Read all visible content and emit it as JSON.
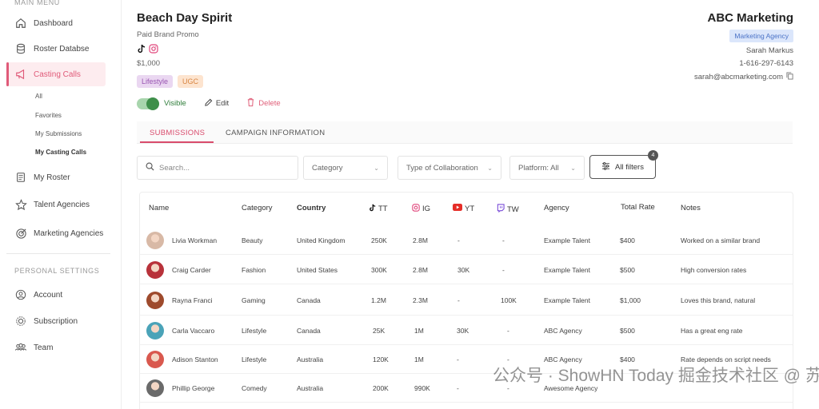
{
  "sidebar": {
    "main_menu_label": "MAIN MENU",
    "items": [
      {
        "label": "Dashboard"
      },
      {
        "label": "Roster Databse"
      },
      {
        "label": "Casting Calls"
      },
      {
        "label": "My Roster"
      },
      {
        "label": "Talent Agencies"
      },
      {
        "label": "Marketing Agencies"
      }
    ],
    "sub_items": [
      {
        "label": "All"
      },
      {
        "label": "Favorites"
      },
      {
        "label": "My Submissions"
      },
      {
        "label": "My Casting Calls"
      }
    ],
    "personal_label": "PERSONAL SETTINGS",
    "personal_items": [
      {
        "label": "Account"
      },
      {
        "label": "Subscription"
      },
      {
        "label": "Team"
      }
    ],
    "accent_color": "#e05a79"
  },
  "header": {
    "title": "Beach Day Spirit",
    "subtitle": "Paid Brand Promo",
    "price": "$1,000",
    "tags": [
      "Lifestyle",
      "UGC"
    ],
    "visible_label": "Visible",
    "edit_label": "Edit",
    "delete_label": "Delete"
  },
  "agency": {
    "name": "ABC Marketing",
    "badge": "Marketing Agency",
    "contact": "Sarah Markus",
    "phone": "1-616-297-6143",
    "email": "sarah@abcmarketing.com"
  },
  "tabs": [
    {
      "label": "SUBMISSIONS"
    },
    {
      "label": "CAMPAIGN INFORMATION"
    }
  ],
  "filters": {
    "search_placeholder": "Search...",
    "category": "Category",
    "collaboration": "Type of Collaboration",
    "platform": "Platform: All",
    "all_filters": "All filters",
    "active_count": "4"
  },
  "table": {
    "headers": {
      "name": "Name",
      "category": "Category",
      "country": "Country",
      "tt": "TT",
      "ig": "IG",
      "yt": "YT",
      "tw": "TW",
      "agency": "Agency",
      "total_rate": "Total Rate",
      "notes": "Notes"
    },
    "rows": [
      {
        "name": "Livia Workman",
        "category": "Beauty",
        "country": "United Kingdom",
        "tt": "250K",
        "ig": "2.8M",
        "yt": "-",
        "tw": "-",
        "agency": "Example Talent",
        "rate": "$400",
        "notes": "Worked on a similar brand",
        "avatar_color": "#d8b9a6"
      },
      {
        "name": "Craig Carder",
        "category": "Fashion",
        "country": "United States",
        "tt": "300K",
        "ig": "2.8M",
        "yt": "30K",
        "tw": "-",
        "agency": "Example Talent",
        "rate": "$500",
        "notes": "High conversion rates",
        "avatar_color": "#b8323a"
      },
      {
        "name": "Rayna Franci",
        "category": "Gaming",
        "country": "Canada",
        "tt": "1.2M",
        "ig": "2.3M",
        "yt": "-",
        "tw": "100K",
        "agency": "Example Talent",
        "rate": "$1,000",
        "notes": "Loves this brand, natural",
        "avatar_color": "#9e4a2c"
      },
      {
        "name": "Carla Vaccaro",
        "category": "Lifestyle",
        "country": "Canada",
        "tt": "25K",
        "ig": "1M",
        "yt": "30K",
        "tw": "-",
        "agency": "ABC Agency",
        "rate": "$500",
        "notes": "Has a great eng rate",
        "avatar_color": "#4aa3b8"
      },
      {
        "name": "Adison Stanton",
        "category": "Lifestyle",
        "country": "Australia",
        "tt": "120K",
        "ig": "1M",
        "yt": "-",
        "tw": "-",
        "agency": "ABC Agency",
        "rate": "$400",
        "notes": "Rate depends on script needs",
        "avatar_color": "#d9584e"
      },
      {
        "name": "Phillip George",
        "category": "Comedy",
        "country": "Australia",
        "tt": "200K",
        "ig": "990K",
        "yt": "-",
        "tw": "-",
        "agency": "Awesome Agency",
        "rate": "",
        "notes": "",
        "avatar_color": "#6a6a6a"
      }
    ]
  },
  "watermark": "公众号 · ShowHN Today  掘金技术社区 @ 苏建深"
}
